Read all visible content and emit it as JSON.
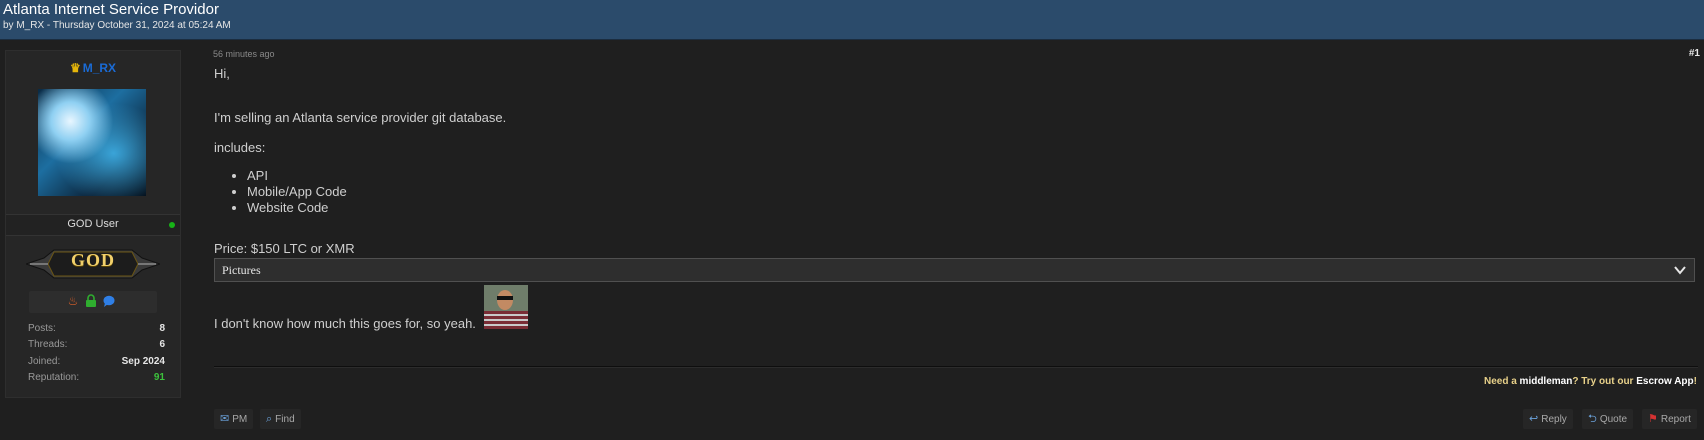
{
  "thread": {
    "title": "Atlanta Internet Service Providor",
    "by_prefix": "by",
    "author": "M_RX",
    "meta_suffix": "- Thursday October 31, 2024 at 05:24 AM"
  },
  "user": {
    "crown_icon": "crown-icon",
    "username": "M_RX",
    "usertitle": "GOD User",
    "online": true,
    "badge_text": "GOD",
    "awards": [
      "fire-icon",
      "lock-icon",
      "chat-bubble-icon"
    ],
    "stats": [
      {
        "label": "Posts:",
        "value": "8"
      },
      {
        "label": "Threads:",
        "value": "6"
      },
      {
        "label": "Joined:",
        "value": "Sep 2024"
      },
      {
        "label": "Reputation:",
        "value": "91"
      }
    ],
    "colors": {
      "username": "#1a6bd6",
      "reputation": "#3cc13c",
      "online": "#17b317"
    }
  },
  "post": {
    "time": "56 minutes ago",
    "number": "#1",
    "greeting": "Hi,",
    "line1": "I'm selling an Atlanta service provider git database.",
    "includes_label": "includes:",
    "items": [
      "API",
      "Mobile/App Code",
      "Website Code"
    ],
    "price": "Price: $150 LTC or XMR",
    "spoiler_label": "Pictures",
    "closing": "I don't know how much this goes for, so yeah."
  },
  "signature": {
    "part1": "Need a ",
    "middleman": "middleman",
    "part2": "? Try out our ",
    "escrow": "Escrow App",
    "part3": "!"
  },
  "actions": {
    "pm": "PM",
    "find": "Find",
    "reply": "Reply",
    "quote": "Quote",
    "report": "Report"
  }
}
